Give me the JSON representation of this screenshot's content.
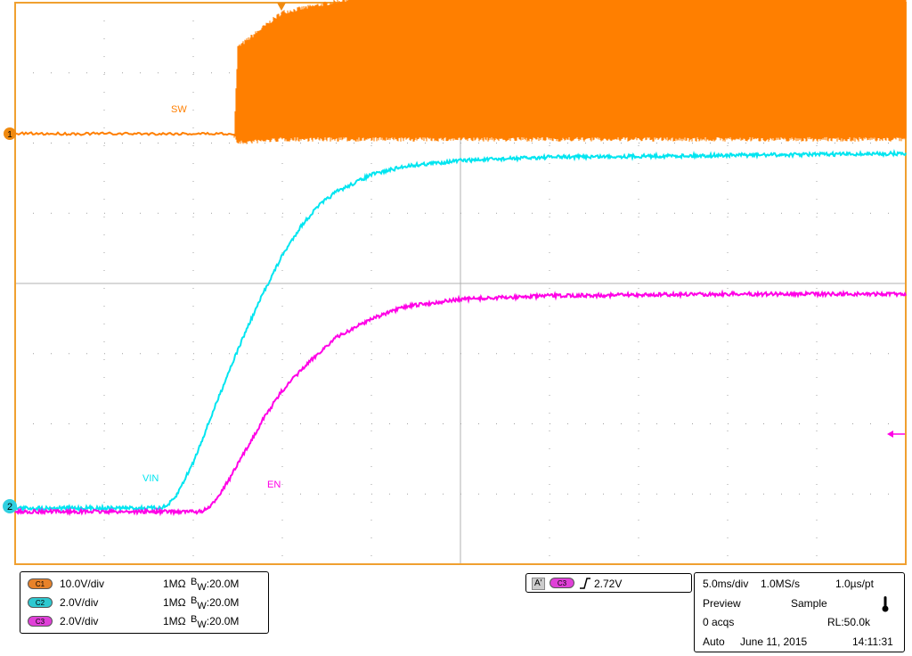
{
  "chart_data": {
    "type": "line",
    "title": "",
    "xlabel": "",
    "ylabel": "",
    "time_per_div_ms": 5.0,
    "divisions_x": 10,
    "divisions_y": 8,
    "xlim_ms": [
      0,
      50
    ],
    "grid": true,
    "series": [
      {
        "name": "SW",
        "channel": "C1",
        "color": "#ff7f00",
        "volts_per_div": 10.0,
        "x_ms": [
          0,
          12.3,
          12.5,
          15,
          20,
          25,
          30,
          35,
          40,
          45,
          50
        ],
        "y_high_v": [
          0,
          0,
          12,
          17,
          19.5,
          20,
          20.2,
          20.2,
          20.2,
          20.2,
          20.2
        ],
        "y_low_v": [
          0,
          0,
          -1,
          -0.5,
          -0.5,
          -0.5,
          -0.5,
          -0.5,
          -0.5,
          -0.5,
          -0.5
        ]
      },
      {
        "name": "VIN",
        "channel": "C2",
        "color": "#00e5f0",
        "volts_per_div": 2.0,
        "x_ms": [
          0,
          8,
          8.5,
          9,
          10,
          11,
          12,
          13,
          14,
          15,
          16,
          17,
          18,
          20,
          22,
          25,
          30,
          40,
          50
        ],
        "y_v": [
          0,
          0,
          0.05,
          0.3,
          1.3,
          2.6,
          3.9,
          5.1,
          6.2,
          7.2,
          8.0,
          8.6,
          9.0,
          9.5,
          9.75,
          9.9,
          10.0,
          10.05,
          10.1
        ]
      },
      {
        "name": "EN",
        "channel": "C3",
        "color": "#ff00e6",
        "volts_per_div": 2.0,
        "x_ms": [
          0,
          10.5,
          11,
          12,
          13,
          14,
          15,
          16,
          17,
          18,
          20,
          22,
          25,
          30,
          40,
          50
        ],
        "y_v": [
          0,
          0,
          0.15,
          0.9,
          1.8,
          2.7,
          3.45,
          4.0,
          4.5,
          4.95,
          5.5,
          5.85,
          6.05,
          6.15,
          6.2,
          6.2
        ]
      }
    ]
  },
  "trace_labels": {
    "sw": "SW",
    "vin": "VIN",
    "en": "EN"
  },
  "markers": {
    "ch1": "1",
    "ch2": "2"
  },
  "channels": [
    {
      "badge": "C1",
      "scale": "10.0V/div",
      "impedance": "1MΩ",
      "bw_b": "B",
      "bw_w": "W",
      "bw_val": ":20.0M",
      "color": "#e8822a"
    },
    {
      "badge": "C2",
      "scale": "2.0V/div",
      "impedance": "1MΩ",
      "bw_b": "B",
      "bw_w": "W",
      "bw_val": ":20.0M",
      "color": "#2ec8d0"
    },
    {
      "badge": "C3",
      "scale": "2.0V/div",
      "impedance": "1MΩ",
      "bw_b": "B",
      "bw_w": "W",
      "bw_val": ":20.0M",
      "color": "#e040d8"
    }
  ],
  "trigger": {
    "mode": "A'",
    "source": "C3",
    "level": "2.72V"
  },
  "acquisition": {
    "timebase": "5.0ms/div",
    "sample_rate": "1.0MS/s",
    "point_time": "1.0µs/pt",
    "state": "Preview",
    "acq_mode": "Sample",
    "acqs": "0 acqs",
    "record_length": "RL:50.0k",
    "trigger_mode": "Auto",
    "date": "June 11, 2015",
    "time": "14:11:31"
  },
  "colors": {
    "frame": "#f0a030",
    "grid": "#a0a0a0",
    "sw": "#ff7f00",
    "vin": "#00e5f0",
    "en": "#ff00e6"
  }
}
